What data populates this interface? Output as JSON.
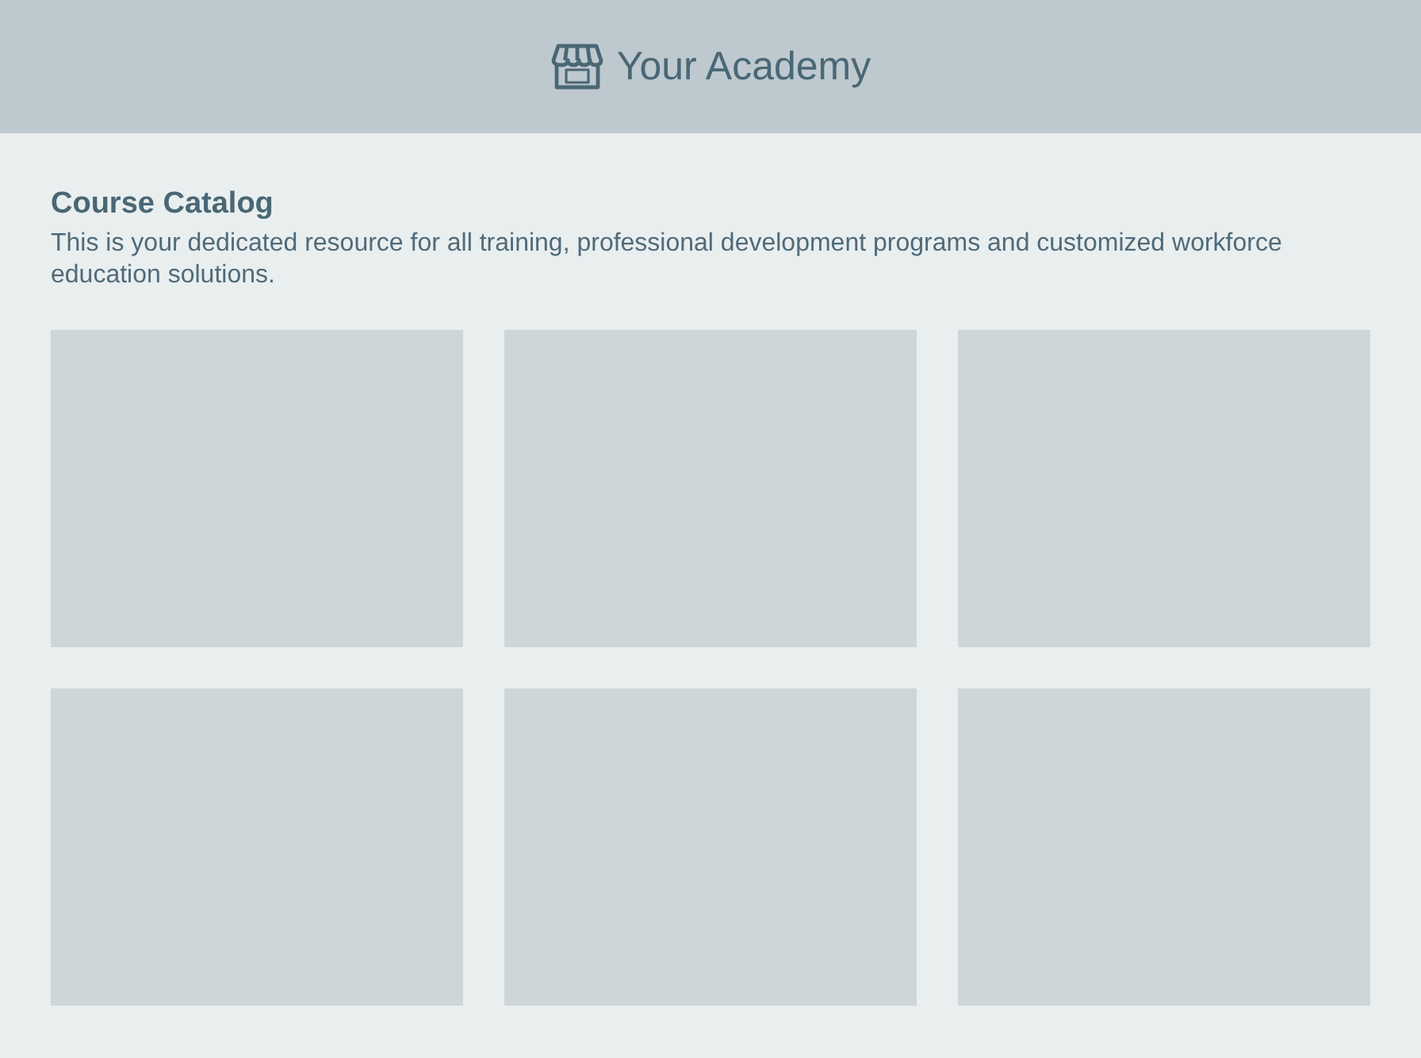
{
  "header": {
    "title": "Your Academy"
  },
  "catalog": {
    "title": "Course Catalog",
    "description": "This is your dedicated resource for all training, professional development programs and customized workforce education solutions."
  },
  "cards": [
    {
      "kind": "placeholder"
    },
    {
      "kind": "placeholder"
    },
    {
      "kind": "placeholder"
    },
    {
      "kind": "placeholder"
    },
    {
      "kind": "placeholder"
    },
    {
      "kind": "placeholder"
    }
  ]
}
